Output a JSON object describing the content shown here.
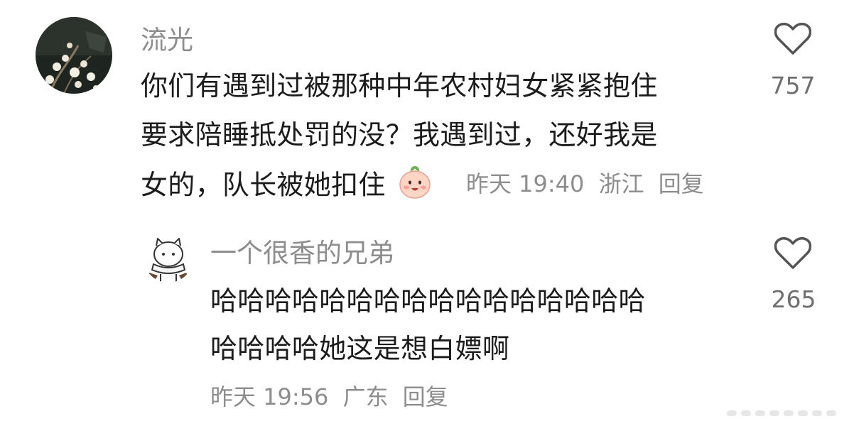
{
  "comment": {
    "username": "流光",
    "lines": [
      "你们有遇到过被那种中年农村妇女紧紧抱住",
      "要求陪睡抵处罚的没？我遇到过，还好我是",
      "女的，队长被她扣住"
    ],
    "emoji_icon": "cute-peach-emoji",
    "time": "昨天 19:40",
    "location": "浙江",
    "reply_label": "回复",
    "like_count": "757"
  },
  "reply": {
    "username": "一个很香的兄弟",
    "lines": [
      "哈哈哈哈哈哈哈哈哈哈哈哈哈哈哈哈",
      "哈哈哈哈她这是想白嫖啊"
    ],
    "time": "昨天 19:56",
    "location": "广东",
    "reply_label": "回复",
    "like_count": "265"
  }
}
